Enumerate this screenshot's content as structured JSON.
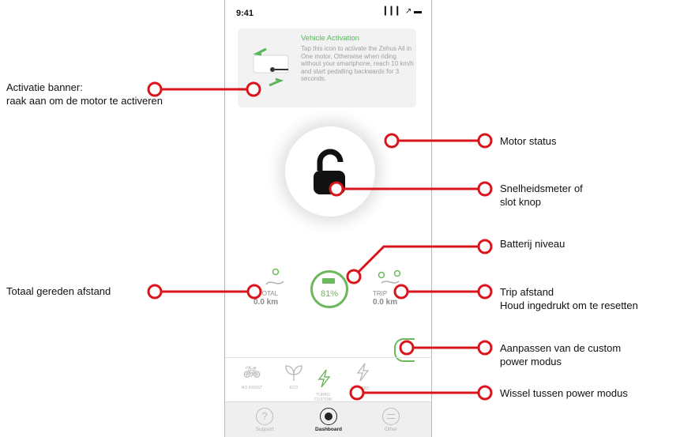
{
  "phone": {
    "status_time": "9:41",
    "status_icons": "▎▎▎ ↗ ▬",
    "banner": {
      "title": "Vehicle Activation",
      "text": "Tap this icon to activate the Zehus All in One motor. Otherwise when riding without your smartphone, reach 10 km/h and start pedalling backwards for 3 seconds."
    },
    "battery_percent": "81%",
    "total": {
      "label": "TOTAL",
      "value": "0.0 km"
    },
    "trip": {
      "label": "TRIP",
      "value": "0.0 km"
    },
    "modes": [
      {
        "label": "NO ASSIST",
        "icon": "bicycle-icon"
      },
      {
        "label": "ECO",
        "icon": "leaf-icon"
      },
      {
        "label": "TURBO CUSTOM",
        "icon": "bolt-icon"
      },
      {
        "label": "TURBO",
        "icon": "bolt-icon"
      }
    ],
    "tabs": [
      {
        "label": "Support",
        "icon": "question-icon"
      },
      {
        "label": "Dashboard",
        "icon": "dashboard-icon"
      },
      {
        "label": "Other",
        "icon": "menu-icon"
      }
    ]
  },
  "annotations": {
    "activation_banner_line1": "Activatie banner:",
    "activation_banner_line2": "raak aan om de motor te activeren",
    "total_distance": "Totaal gereden afstand",
    "motor_status": "Motor status",
    "speedometer_line1": "Snelheidsmeter of",
    "speedometer_line2": "slot knop",
    "battery_level": "Batterij niveau",
    "trip_line1": "Trip afstand",
    "trip_line2": "Houd ingedrukt om te resetten",
    "custom_mode_line1": "Aanpassen van de custom",
    "custom_mode_line2": "power modus",
    "switch_mode": "Wissel tussen power modus"
  },
  "colors": {
    "accent_red": "#d9141c",
    "green": "#6cb85c"
  }
}
